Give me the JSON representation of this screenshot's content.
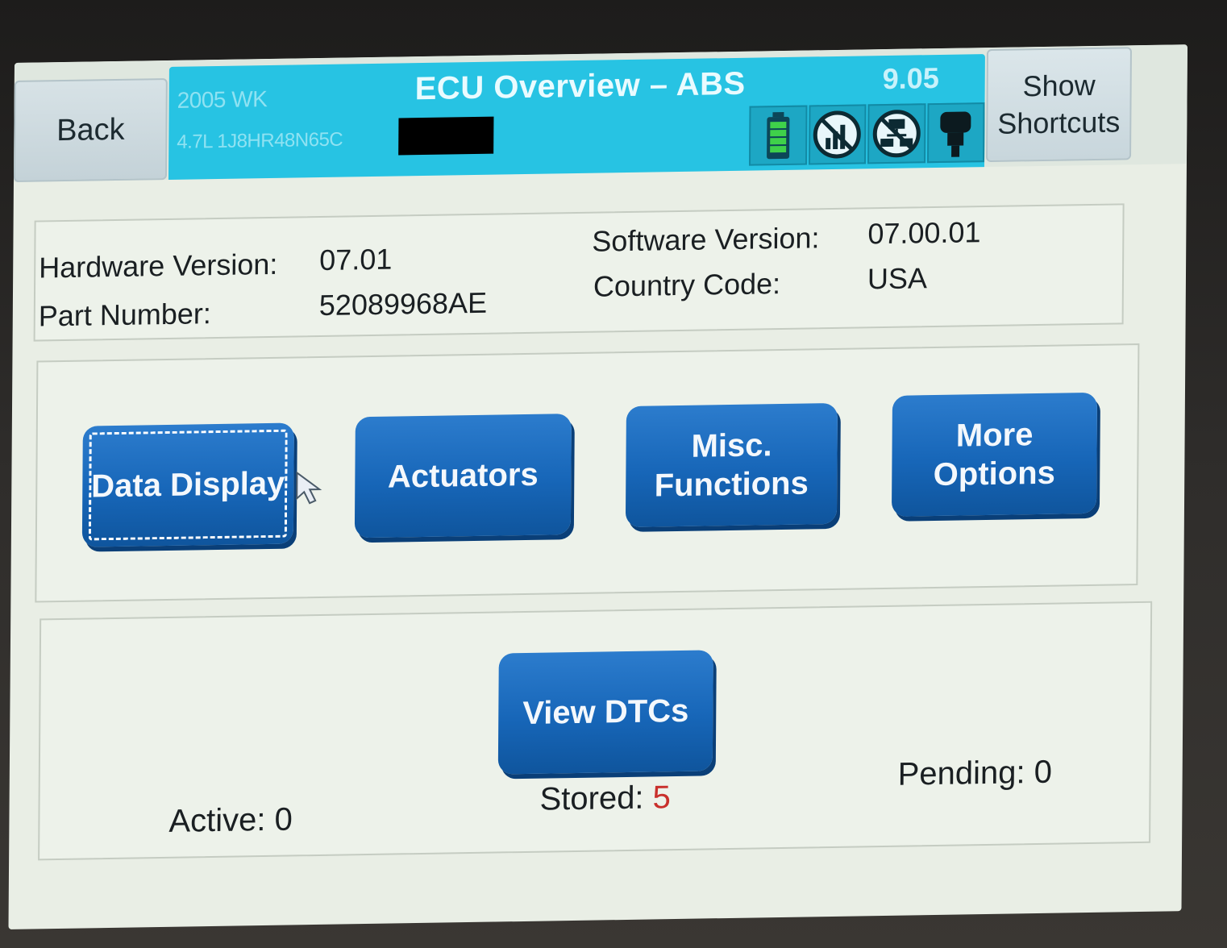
{
  "header": {
    "back_label": "Back",
    "vehicle_year_model": "2005 WK",
    "vehicle_engine_vin": "4.7L 1J8HR48N65C",
    "title": "ECU Overview – ABS",
    "version": "9.05",
    "status_icons": [
      "battery-icon",
      "no-signal-icon",
      "network-icon",
      "connector-icon"
    ],
    "shortcuts_line1": "Show",
    "shortcuts_line2": "Shortcuts"
  },
  "info": {
    "hardware_label": "Hardware Version:",
    "hardware_value": "07.01",
    "part_label": "Part Number:",
    "part_value": "52089968AE",
    "software_label": "Software Version:",
    "software_value": "07.00.01",
    "country_label": "Country Code:",
    "country_value": "USA"
  },
  "actions": {
    "data_display": "Data Display",
    "actuators": "Actuators",
    "misc_line1": "Misc.",
    "misc_line2": "Functions",
    "more_line1": "More",
    "more_line2": "Options"
  },
  "dtc": {
    "view_label": "View DTCs",
    "active_label": "Active:",
    "active_value": "0",
    "stored_label": "Stored:",
    "stored_value": "5",
    "pending_label": "Pending:",
    "pending_value": "0"
  },
  "colors": {
    "header_band": "#27c3e3",
    "button_blue": "#1766b8",
    "stored_red": "#c9302c"
  }
}
